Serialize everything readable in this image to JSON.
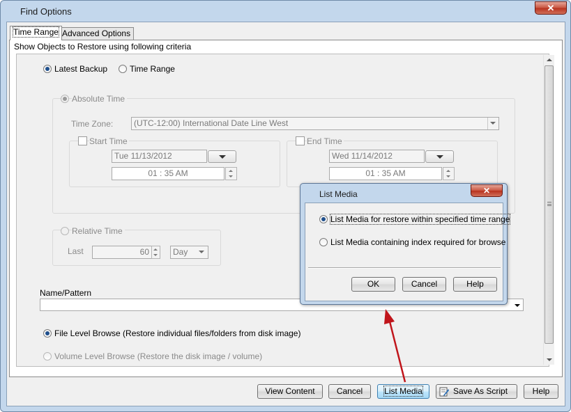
{
  "window": {
    "title": "Find Options",
    "close_label": "✕"
  },
  "tabs": [
    {
      "label": "Time Range",
      "active": true
    },
    {
      "label": "Advanced Options",
      "active": false
    }
  ],
  "criteria_caption": "Show Objects to Restore using following criteria",
  "backup_mode": {
    "latest_label": "Latest Backup",
    "range_label": "Time Range",
    "selected": "Latest Backup"
  },
  "absolute": {
    "label": "Absolute Time",
    "timezone_label": "Time Zone:",
    "timezone_value": "(UTC-12:00) International Date Line West",
    "start": {
      "label": "Start Time",
      "date": "Tue 11/13/2012",
      "time": "01 : 35 AM"
    },
    "end": {
      "label": "End Time",
      "date": "Wed 11/14/2012",
      "time": "01 : 35 AM"
    }
  },
  "relative": {
    "label": "Relative Time",
    "last_label": "Last",
    "last_value": "60",
    "unit": "Day"
  },
  "name_pattern": {
    "label": "Name/Pattern",
    "value": ""
  },
  "browse": {
    "file_level": "File Level Browse (Restore individual files/folders from disk image)",
    "volume_level": "Volume Level Browse (Restore the disk image / volume)",
    "selected": "file_level"
  },
  "footer_buttons": {
    "view_content": "View Content",
    "cancel": "Cancel",
    "list_media": "List Media",
    "save_as_script": "Save As Script",
    "help": "Help"
  },
  "list_media_dialog": {
    "title": "List Media",
    "close_label": "✕",
    "option1": "List Media for restore within specified time range",
    "option2": "List Media containing index required for browse",
    "selected": "option1",
    "ok": "OK",
    "cancel": "Cancel",
    "help": "Help"
  },
  "colors": {
    "accent": "#1f4f8c",
    "annotation_arrow": "#c0151b",
    "close_button": "#c8543f"
  }
}
